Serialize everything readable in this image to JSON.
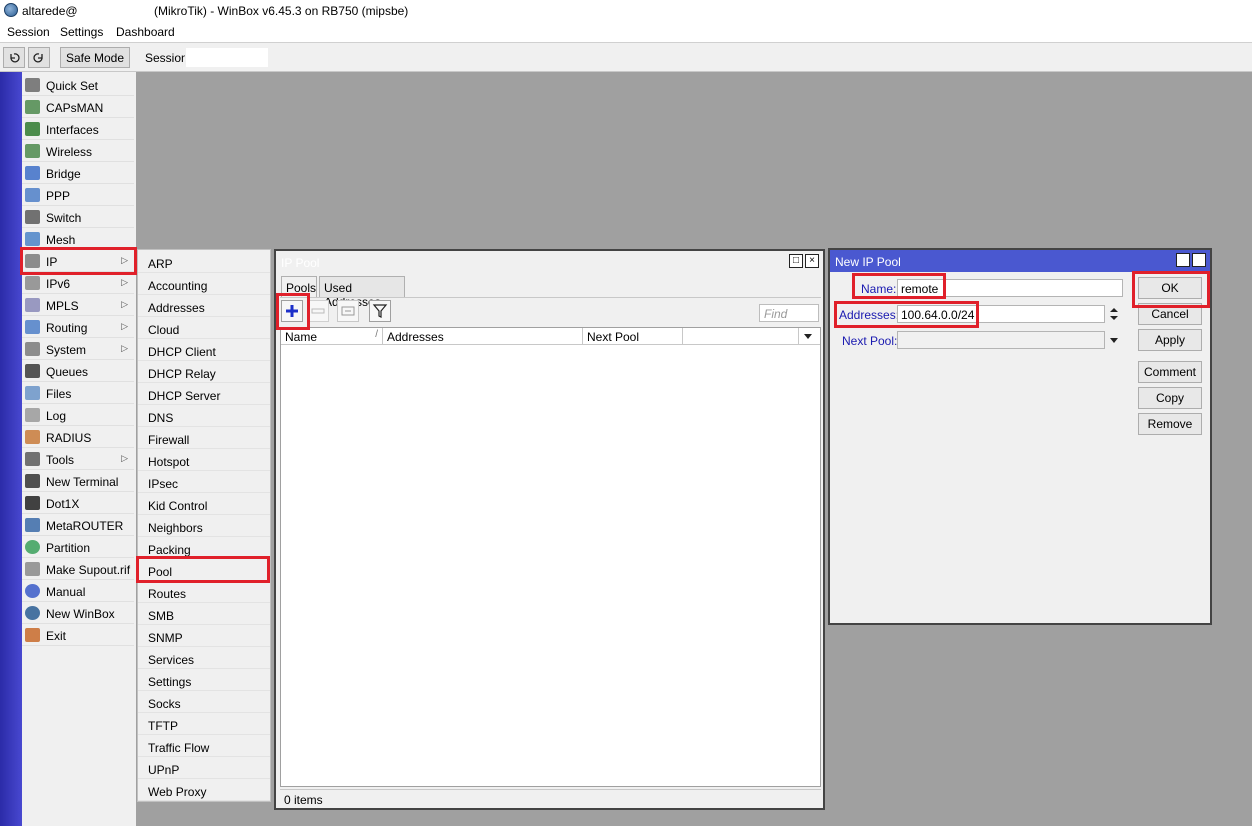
{
  "titlebar": {
    "user": "altarede@",
    "title": "(MikroTik) - WinBox v6.45.3 on RB750 (mipsbe)"
  },
  "menubar": {
    "items": [
      "Session",
      "Settings",
      "Dashboard"
    ]
  },
  "toolbar": {
    "undo_icon": "undo-icon",
    "redo_icon": "redo-icon",
    "safe_mode_label": "Safe Mode",
    "session_label": "Session:",
    "session_value": ""
  },
  "sidebar": {
    "items": [
      {
        "label": "Quick Set",
        "icon": "wand-icon"
      },
      {
        "label": "CAPsMAN",
        "icon": "antenna-icon"
      },
      {
        "label": "Interfaces",
        "icon": "interface-icon"
      },
      {
        "label": "Wireless",
        "icon": "antenna-icon"
      },
      {
        "label": "Bridge",
        "icon": "bridge-icon"
      },
      {
        "label": "PPP",
        "icon": "ppp-icon"
      },
      {
        "label": "Switch",
        "icon": "switch-icon"
      },
      {
        "label": "Mesh",
        "icon": "mesh-icon"
      },
      {
        "label": "IP",
        "icon": "ip-icon",
        "submenu": true
      },
      {
        "label": "IPv6",
        "icon": "ipv6-icon",
        "submenu": true
      },
      {
        "label": "MPLS",
        "icon": "mpls-icon",
        "submenu": true
      },
      {
        "label": "Routing",
        "icon": "routing-icon",
        "submenu": true
      },
      {
        "label": "System",
        "icon": "gear-icon",
        "submenu": true
      },
      {
        "label": "Queues",
        "icon": "queues-icon"
      },
      {
        "label": "Files",
        "icon": "folder-icon"
      },
      {
        "label": "Log",
        "icon": "log-icon"
      },
      {
        "label": "RADIUS",
        "icon": "users-icon"
      },
      {
        "label": "Tools",
        "icon": "tools-icon",
        "submenu": true
      },
      {
        "label": "New Terminal",
        "icon": "terminal-icon"
      },
      {
        "label": "Dot1X",
        "icon": "dot1x-icon"
      },
      {
        "label": "MetaROUTER",
        "icon": "metarouter-icon"
      },
      {
        "label": "Partition",
        "icon": "pie-icon"
      },
      {
        "label": "Make Supout.rif",
        "icon": "document-icon"
      },
      {
        "label": "Manual",
        "icon": "help-icon"
      },
      {
        "label": "New WinBox",
        "icon": "winbox-icon"
      },
      {
        "label": "Exit",
        "icon": "exit-icon"
      }
    ]
  },
  "ip_submenu": {
    "items": [
      "ARP",
      "Accounting",
      "Addresses",
      "Cloud",
      "DHCP Client",
      "DHCP Relay",
      "DHCP Server",
      "DNS",
      "Firewall",
      "Hotspot",
      "IPsec",
      "Kid Control",
      "Neighbors",
      "Packing",
      "Pool",
      "Routes",
      "SMB",
      "SNMP",
      "Services",
      "Settings",
      "Socks",
      "TFTP",
      "Traffic Flow",
      "UPnP",
      "Web Proxy"
    ]
  },
  "pool_window": {
    "title": "IP Pool",
    "tabs": [
      "Pools",
      "Used Addresses"
    ],
    "find_placeholder": "Find",
    "columns": [
      "Name",
      "Addresses",
      "Next Pool"
    ],
    "status": "0 items"
  },
  "new_pool_window": {
    "title": "New IP Pool",
    "name_label": "Name:",
    "name_value": "remote",
    "addresses_label": "Addresses:",
    "addresses_value": "100.64.0.0/24",
    "next_pool_label": "Next Pool:",
    "next_pool_value": "",
    "buttons": [
      "OK",
      "Cancel",
      "Apply",
      "Comment",
      "Copy",
      "Remove"
    ]
  },
  "colors": {
    "highlight": "#e0202a",
    "sidebar_bar": "#3a3ac0",
    "dialog_title": "#4a58d0",
    "field_label": "#1a1ab0"
  }
}
